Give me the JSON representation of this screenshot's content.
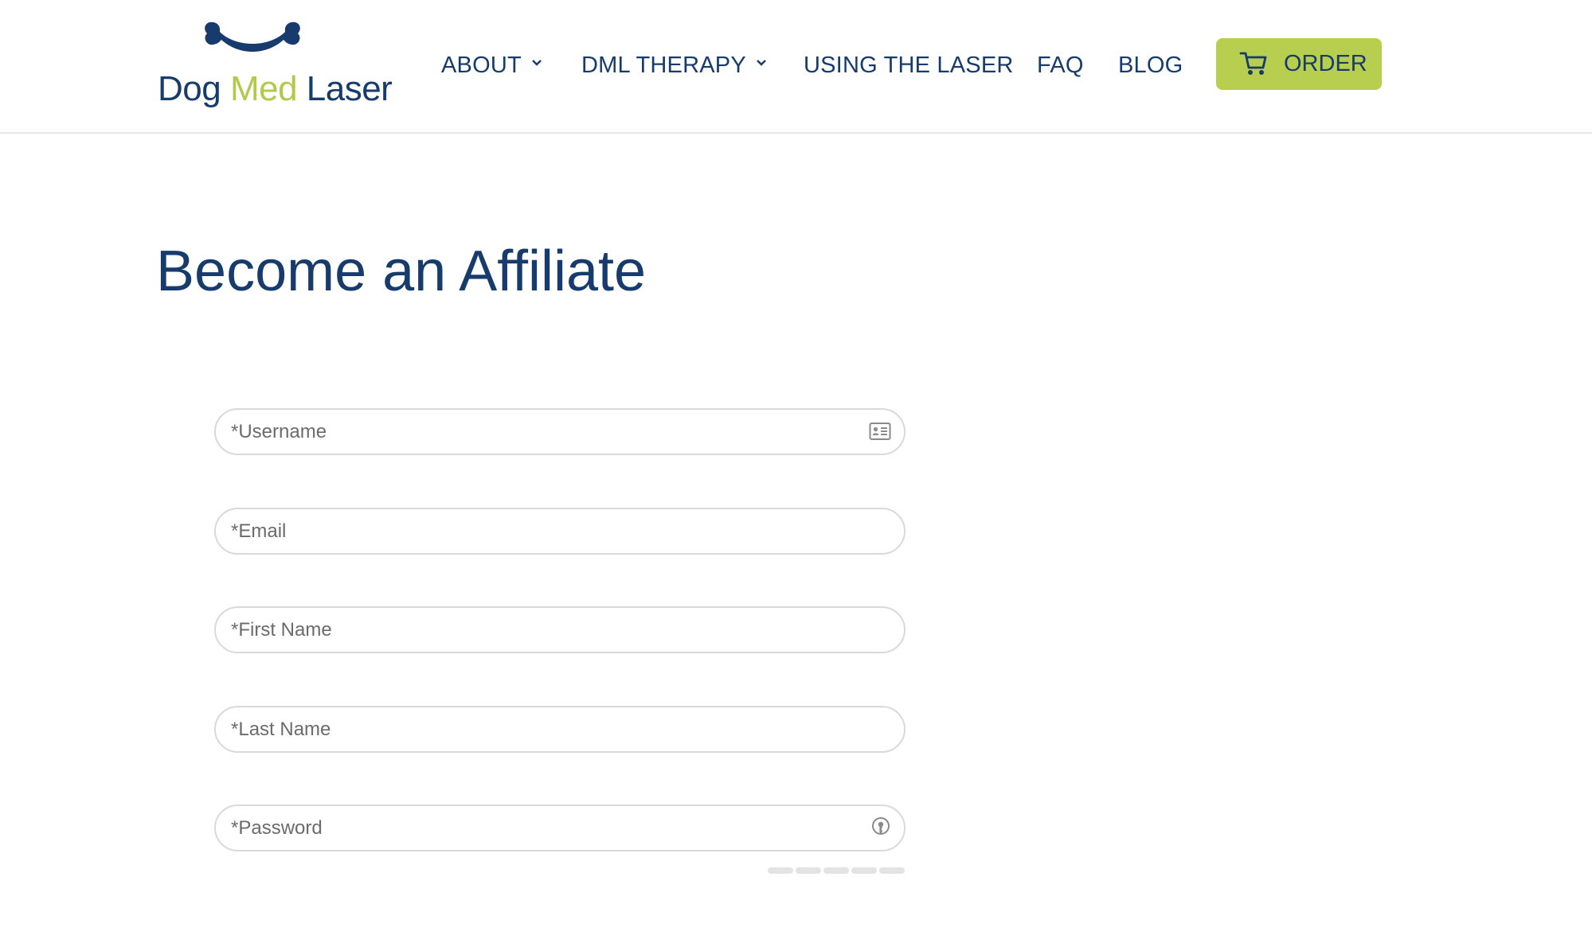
{
  "brand": {
    "logo_part1": "Dog ",
    "logo_part2": "Med",
    "logo_part3": " Laser",
    "colors": {
      "navy": "#173b6c",
      "lime": "#b8ce4e",
      "logo_green": "#b2c94a"
    }
  },
  "nav": {
    "items": [
      {
        "label": "ABOUT",
        "has_dropdown": true
      },
      {
        "label": "DML THERAPY",
        "has_dropdown": true
      },
      {
        "label": "USING THE LASER",
        "has_dropdown": false
      },
      {
        "label": "FAQ",
        "has_dropdown": false
      },
      {
        "label": "BLOG",
        "has_dropdown": false
      }
    ],
    "order": {
      "label": "ORDER",
      "icon": "cart-icon"
    }
  },
  "page": {
    "title": "Become an Affiliate"
  },
  "form": {
    "username": {
      "placeholder": "*Username",
      "icon": "id-card-icon"
    },
    "email": {
      "placeholder": "*Email"
    },
    "first_name": {
      "placeholder": "*First Name"
    },
    "last_name": {
      "placeholder": "*Last Name"
    },
    "password": {
      "placeholder": "*Password",
      "icon": "key-icon"
    },
    "password_strength": {
      "segments": 5,
      "filled": 0
    }
  }
}
